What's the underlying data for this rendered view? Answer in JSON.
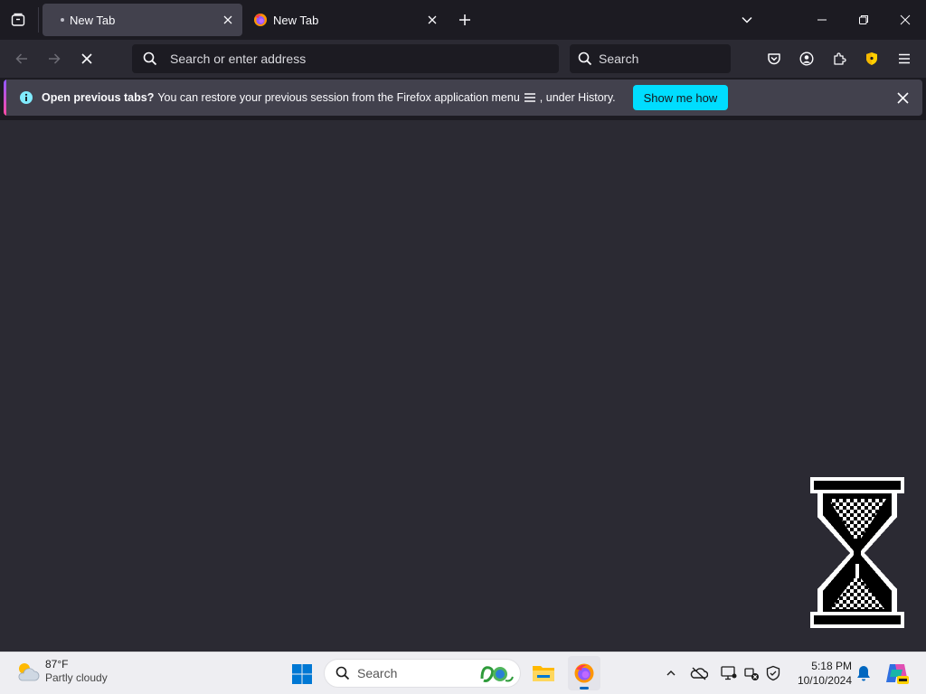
{
  "browser": {
    "tabs": [
      {
        "title": "New Tab",
        "active": true,
        "loading": true
      },
      {
        "title": "New Tab",
        "active": false,
        "loading": false
      }
    ],
    "urlbar": {
      "placeholder": "Search or enter address"
    },
    "searchbar": {
      "placeholder": "Search"
    },
    "notification": {
      "bold_text": "Open previous tabs?",
      "text_before_icon": "You can restore your previous session from the Firefox application menu",
      "text_after_icon": ", under History.",
      "action_label": "Show me how"
    },
    "colors": {
      "frame": "#1c1b22",
      "toolbar": "#2b2a33",
      "selected_tab": "#42414d",
      "accent_button": "#00ddff"
    }
  },
  "taskbar": {
    "weather": {
      "temperature": "87°F",
      "condition": "Partly cloudy",
      "icon": "partly-cloudy-icon"
    },
    "search_label": "Search",
    "clock": {
      "time": "5:18 PM",
      "date": "10/10/2024"
    }
  }
}
